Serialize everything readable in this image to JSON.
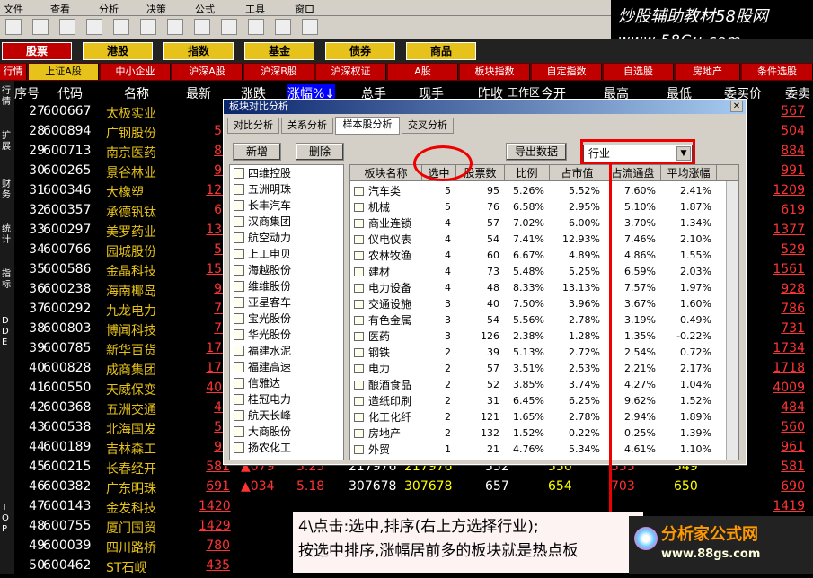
{
  "menubar": [
    "文件",
    "查看",
    "分析",
    "决策",
    "公式",
    "工具",
    "窗口"
  ],
  "brand": {
    "line1": "炒股辅助教材58股网",
    "line2": "www.58Gu.com"
  },
  "modules": [
    "股票",
    "港股",
    "指数",
    "基金",
    "债券",
    "商品"
  ],
  "workarea": "工作区",
  "tabs": [
    "行情",
    "上证A股",
    "中小企业",
    "沪深A股",
    "沪深B股",
    "沪深权证",
    "A股",
    "板块指数",
    "自定指数",
    "自选股",
    "房地产",
    "条件选股"
  ],
  "sidevert": [
    "行情",
    "扩展",
    "财务",
    "统计",
    "指标",
    "DDE",
    "TOP"
  ],
  "columns": [
    "序号",
    "代码",
    "名称",
    "最新",
    "涨跌",
    "涨幅%↓",
    "总手",
    "现手",
    "昨收",
    "今开",
    "最高",
    "最低",
    "委买价",
    "委卖"
  ],
  "rows": [
    {
      "no": "27",
      "code": "600667",
      "name": "太极实业",
      "p": "",
      "r": "567"
    },
    {
      "no": "28",
      "code": "600894",
      "name": "广钢股份",
      "p": "50",
      "r": "504"
    },
    {
      "no": "29",
      "code": "600713",
      "name": "南京医药",
      "p": "88",
      "r": "884"
    },
    {
      "no": "30",
      "code": "600265",
      "name": "景谷林业",
      "p": "99",
      "r": "991"
    },
    {
      "no": "31",
      "code": "600346",
      "name": "大橡塑",
      "p": "120",
      "r": "1209"
    },
    {
      "no": "32",
      "code": "600357",
      "name": "承德钒钛",
      "p": "61",
      "r": "619"
    },
    {
      "no": "33",
      "code": "600297",
      "name": "美罗药业",
      "p": "137",
      "r": "1377"
    },
    {
      "no": "34",
      "code": "600766",
      "name": "园城股份",
      "p": "52",
      "r": "529"
    },
    {
      "no": "35",
      "code": "600586",
      "name": "金晶科技",
      "p": "156",
      "r": "1561"
    },
    {
      "no": "36",
      "code": "600238",
      "name": "海南椰岛",
      "p": "92",
      "r": "928"
    },
    {
      "no": "37",
      "code": "600292",
      "name": "九龙电力",
      "p": "78",
      "r": "786"
    },
    {
      "no": "38",
      "code": "600803",
      "name": "博闻科技",
      "p": "73",
      "r": "731"
    },
    {
      "no": "39",
      "code": "600785",
      "name": "新华百货",
      "p": "173",
      "r": "1734"
    },
    {
      "no": "40",
      "code": "600828",
      "name": "成商集团",
      "p": "171",
      "r": "1718"
    },
    {
      "no": "41",
      "code": "600550",
      "name": "天威保变",
      "p": "400",
      "r": "4009"
    },
    {
      "no": "42",
      "code": "600368",
      "name": "五洲交通",
      "p": "48",
      "r": "484"
    },
    {
      "no": "43",
      "code": "600538",
      "name": "北海国发",
      "p": "56",
      "r": "560"
    },
    {
      "no": "44",
      "code": "600189",
      "name": "吉林森工",
      "p": "96",
      "r": "961"
    },
    {
      "no": "45",
      "code": "600215",
      "name": "长春经开",
      "p": "581",
      "r": "581"
    },
    {
      "no": "46",
      "code": "600382",
      "name": "广东明珠",
      "p": "691",
      "r": "690"
    },
    {
      "no": "47",
      "code": "600143",
      "name": "金发科技",
      "p": "1420",
      "r": "1419"
    },
    {
      "no": "48",
      "code": "600755",
      "name": "厦门国贸",
      "p": "1429",
      "r": "1428"
    },
    {
      "no": "49",
      "code": "600039",
      "name": "四川路桥",
      "p": "780",
      "r": "780"
    },
    {
      "no": "50",
      "code": "600462",
      "name": "ST石岘",
      "p": "435",
      "r": "434"
    }
  ],
  "extra45": [
    "▲079",
    "5.25",
    "217976",
    "217976",
    "552",
    "550",
    "555",
    "549"
  ],
  "extra46": [
    "▲034",
    "5.18",
    "307678",
    "307678",
    "657",
    "654",
    "703",
    "650"
  ],
  "dialog": {
    "title": "板块对比分析",
    "close": "✕",
    "tabs": [
      "对比分析",
      "关系分析",
      "样本股分析",
      "交叉分析"
    ],
    "btn_add": "新增",
    "btn_del": "删除",
    "btn_export": "导出数据",
    "select": "行业",
    "stocks": [
      "四维控股",
      "五洲明珠",
      "长丰汽车",
      "汉商集团",
      "航空动力",
      "上工申贝",
      "海越股份",
      "维维股份",
      "亚星客车",
      "宝光股份",
      "华光股份",
      "福建水泥",
      "福建高速",
      "信雅达",
      "桂冠电力",
      "航天长峰",
      "大商股份",
      "扬农化工"
    ],
    "headers": [
      "板块名称",
      "选中",
      "股票数",
      "比例",
      "占市值",
      "占流通盘",
      "平均涨幅"
    ],
    "grid": [
      [
        "汽车类",
        "5",
        "95",
        "5.26%",
        "5.52%",
        "7.60%",
        "2.41%"
      ],
      [
        "机械",
        "5",
        "76",
        "6.58%",
        "2.95%",
        "5.10%",
        "1.87%"
      ],
      [
        "商业连锁",
        "4",
        "57",
        "7.02%",
        "6.00%",
        "3.70%",
        "1.34%"
      ],
      [
        "仪电仪表",
        "4",
        "54",
        "7.41%",
        "12.93%",
        "7.46%",
        "2.10%"
      ],
      [
        "农林牧渔",
        "4",
        "60",
        "6.67%",
        "4.89%",
        "4.86%",
        "1.55%"
      ],
      [
        "建材",
        "4",
        "73",
        "5.48%",
        "5.25%",
        "6.59%",
        "2.03%"
      ],
      [
        "电力设备",
        "4",
        "48",
        "8.33%",
        "13.13%",
        "7.57%",
        "1.97%"
      ],
      [
        "交通设施",
        "3",
        "40",
        "7.50%",
        "3.96%",
        "3.67%",
        "1.60%"
      ],
      [
        "有色金属",
        "3",
        "54",
        "5.56%",
        "2.78%",
        "3.19%",
        "0.49%"
      ],
      [
        "医药",
        "3",
        "126",
        "2.38%",
        "1.28%",
        "1.35%",
        "-0.22%"
      ],
      [
        "钢铁",
        "2",
        "39",
        "5.13%",
        "2.72%",
        "2.54%",
        "0.72%"
      ],
      [
        "电力",
        "2",
        "57",
        "3.51%",
        "2.53%",
        "2.21%",
        "2.17%"
      ],
      [
        "酿酒食品",
        "2",
        "52",
        "3.85%",
        "3.74%",
        "4.27%",
        "1.04%"
      ],
      [
        "造纸印刷",
        "2",
        "31",
        "6.45%",
        "6.25%",
        "9.62%",
        "1.52%"
      ],
      [
        "化工化纤",
        "2",
        "121",
        "1.65%",
        "2.78%",
        "2.94%",
        "1.89%"
      ],
      [
        "房地产",
        "2",
        "132",
        "1.52%",
        "0.22%",
        "0.25%",
        "1.39%"
      ],
      [
        "外贸",
        "1",
        "21",
        "4.76%",
        "5.34%",
        "4.61%",
        "1.10%"
      ]
    ]
  },
  "note": {
    "line1": "4\\点击:选中,排序(右上方选择行业);",
    "line2": "按选中排序,涨幅居前多的板块就是热点板"
  },
  "logo2": {
    "title": "分析家公式网",
    "url": "www.88gs.com"
  }
}
